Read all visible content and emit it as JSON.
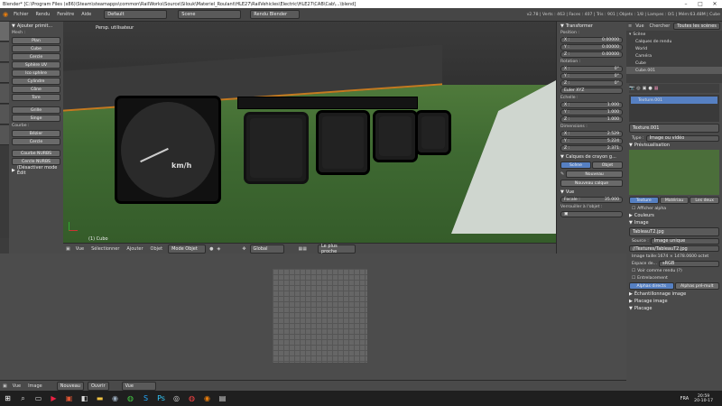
{
  "titlebar": {
    "title": "Blender* [C:\\Program Files (x86)\\Steam\\steamapps\\common\\RailWorks\\Source\\Silouk\\Materiel_Roulant\\HLE27\\RailVehicles\\Electric\\HLE27\\CAB\\Cab\\...\\blend]"
  },
  "menu": {
    "items": [
      "Fichier",
      "Rendu",
      "Fenêtre",
      "Aide"
    ]
  },
  "infobar": {
    "layout": "Default",
    "scene": "Scene",
    "engine": "Rendu Blender",
    "stats": "v2.78 | Verts : 463 | Faces : 407 | Tris : 901 | Objets : 1/8 | Lampes : 0/1 | Mém:63.48M | Cube"
  },
  "toolshelf": {
    "title": "Ajouter primit...",
    "mesh_label": "Mesh :",
    "mesh": [
      "Plan",
      "Cube",
      "Cercle",
      "Sphère UV",
      "Ico sphère",
      "Cylindre",
      "Cône",
      "Tore"
    ],
    "grid": [
      "Grille",
      "Singe"
    ],
    "curve_label": "Courbe :",
    "curve": [
      "Bézier",
      "Cercle"
    ],
    "nurbs": [
      "Courbe NURBS",
      "Cercle NURBS"
    ],
    "last_op": "(Désactiver mode Édit"
  },
  "viewport": {
    "label": "Persp. utilisateur",
    "object_label": "(1) Cubo",
    "gauge_unit": "km/h"
  },
  "viewport_header": {
    "items": [
      "Vue",
      "Sélectionner",
      "Ajouter",
      "Objet"
    ],
    "mode": "Mode Objet",
    "orientation": "Global",
    "pivot": "Le plus proche"
  },
  "npanel": {
    "title": "Transformer",
    "position_label": "Position :",
    "position": [
      {
        "axis": "X :",
        "val": "0.00000"
      },
      {
        "axis": "Y :",
        "val": "0.00000"
      },
      {
        "axis": "Z :",
        "val": "0.00000"
      }
    ],
    "rotation_label": "Rotation :",
    "rotation": [
      {
        "axis": "X :",
        "val": "0°"
      },
      {
        "axis": "Y :",
        "val": "0°"
      },
      {
        "axis": "Z :",
        "val": "0°"
      }
    ],
    "euler": "Euler XYZ",
    "scale_label": "Echelle :",
    "scale": [
      {
        "axis": "X :",
        "val": "1.000"
      },
      {
        "axis": "Y :",
        "val": "1.000"
      },
      {
        "axis": "Z :",
        "val": "1.000"
      }
    ],
    "dims_label": "Dimensions :",
    "dims": [
      {
        "axis": "X :",
        "val": "2.529"
      },
      {
        "axis": "Y :",
        "val": "5.224"
      },
      {
        "axis": "Z :",
        "val": "2.371"
      }
    ],
    "gpencil_title": "Calques de crayon g...",
    "gpencil_tabs": [
      "Scène",
      "Objet"
    ],
    "gpencil_new": "Nouveau",
    "gpencil_new_layer": "Nouveau calque",
    "view_title": "Vue",
    "focale_label": "Focale :",
    "focale": "35.000",
    "lock_label": "Verrouiller à l'objet :"
  },
  "outliner": {
    "tabs": [
      "Vue",
      "Chercher",
      "Toutes les scènes"
    ],
    "items": [
      "Scène",
      "Calques de rendu",
      "World",
      "Caméra",
      "Cube",
      "Cube.001"
    ]
  },
  "props": {
    "texture_name": "Texture.001",
    "texture_field": "Texture.001",
    "type_label": "Type :",
    "type": "Image ou vidéo",
    "preview_title": "Prévisualisation",
    "tabs": [
      "Texture",
      "Matériau",
      "Les deux"
    ],
    "alpha": "Afficher alpha",
    "colors": "Couleurs",
    "image_title": "Image",
    "image_name": "TableauT2.jpg",
    "source_label": "Source :",
    "source": "Image unique",
    "path": "//Textures/TableauT2.jpg",
    "info": "Image taille:1674 × 1478.0600 octet",
    "colorspace_label": "Espace de...",
    "colorspace": "sRGB",
    "view_as_render": "Voir comme rendu (?)",
    "interlace": "Entrelacement",
    "alpha_buttons": [
      "Alphas directs",
      "Alphas pré-mult"
    ],
    "mapping": "Échantillonnage image",
    "image_mapping": "Placage image",
    "placage": "Placage"
  },
  "uv_header": {
    "items": [
      "Vue",
      "Image"
    ],
    "new": "Nouveau",
    "open": "Ouvrir",
    "view": "Vue"
  },
  "taskbar": {
    "lang": "FRA",
    "time": "20:59",
    "date": "20-10-17"
  }
}
